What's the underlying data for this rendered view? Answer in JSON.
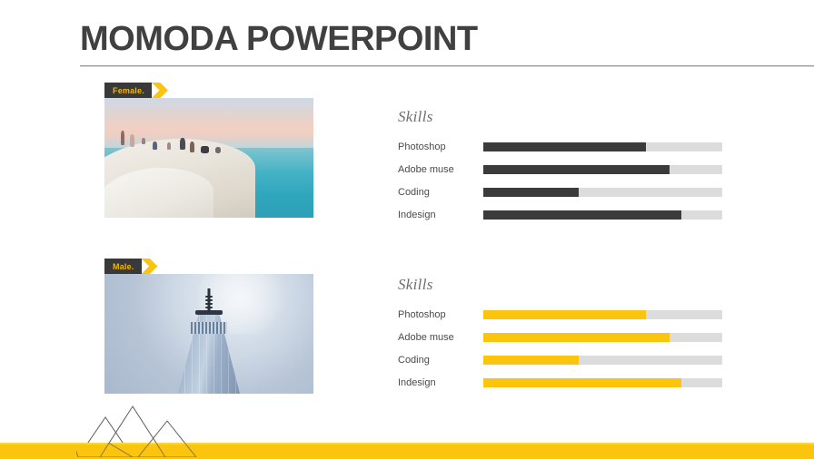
{
  "slide": {
    "title": "MOMODA POWERPOINT",
    "accent_color": "#FBC40D",
    "dark_color": "#3B3B3B",
    "track_color": "#DCDCDC"
  },
  "blocks": [
    {
      "tag_label": "Female.",
      "photo_alt": "people sitting on a white cliff above a turquoise sea at sunset",
      "skills_title": "Skills",
      "bar_style": "dark",
      "skills": [
        {
          "label": "Photoshop",
          "value": 68
        },
        {
          "label": "Adobe muse",
          "value": 78
        },
        {
          "label": "Coding",
          "value": 40
        },
        {
          "label": "Indesign",
          "value": 83
        }
      ]
    },
    {
      "tag_label": "Male.",
      "photo_alt": "skyscraper with spire against a hazy blue sky",
      "skills_title": "Skills",
      "bar_style": "gold",
      "skills": [
        {
          "label": "Photoshop",
          "value": 68
        },
        {
          "label": "Adobe muse",
          "value": 78
        },
        {
          "label": "Coding",
          "value": 40
        },
        {
          "label": "Indesign",
          "value": 83
        }
      ]
    }
  ],
  "decoration": {
    "triangles_count": 3,
    "triangle_outline_color": "#5A5A5A",
    "bottom_bar_color": "#FBC40D"
  }
}
